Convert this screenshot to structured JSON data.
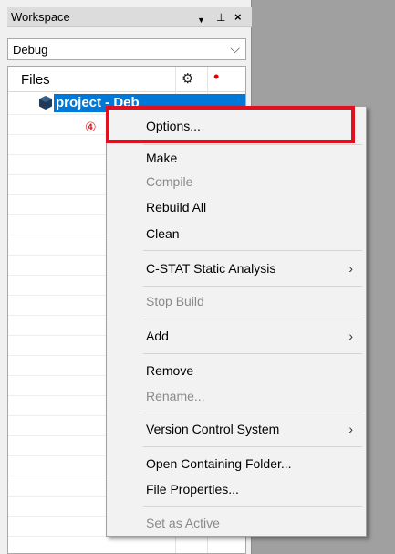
{
  "workspace": {
    "title": "Workspace",
    "controls": {
      "dropdown_icon": "▼",
      "pin_icon": "⊥",
      "close_icon": "×"
    },
    "configuration": {
      "value": "Debug"
    },
    "tree": {
      "header": {
        "files_label": "Files",
        "gear_icon": "gear-icon",
        "status_icon": "red-dot-icon"
      },
      "project": {
        "label": "project - Deb",
        "selected": true
      },
      "step_marker": "④"
    }
  },
  "context_menu": {
    "items": [
      {
        "label": "Options...",
        "enabled": true,
        "submenu": false
      },
      {
        "label": "Make",
        "enabled": true,
        "submenu": false
      },
      {
        "label": "Compile",
        "enabled": false,
        "submenu": false
      },
      {
        "label": "Rebuild All",
        "enabled": true,
        "submenu": false
      },
      {
        "label": "Clean",
        "enabled": true,
        "submenu": false
      },
      {
        "label": "C-STAT Static Analysis",
        "enabled": true,
        "submenu": true
      },
      {
        "label": "Stop Build",
        "enabled": false,
        "submenu": false
      },
      {
        "label": "Add",
        "enabled": true,
        "submenu": true
      },
      {
        "label": "Remove",
        "enabled": true,
        "submenu": false
      },
      {
        "label": "Rename...",
        "enabled": false,
        "submenu": false
      },
      {
        "label": "Version Control System",
        "enabled": true,
        "submenu": true
      },
      {
        "label": "Open Containing Folder...",
        "enabled": true,
        "submenu": false
      },
      {
        "label": "File Properties...",
        "enabled": true,
        "submenu": false
      },
      {
        "label": "Set as Active",
        "enabled": false,
        "submenu": false
      }
    ],
    "submenu_arrow": "›"
  },
  "colors": {
    "selection": "#0078d7",
    "highlight_box": "#e01020",
    "step_marker": "#e00000",
    "disabled_text": "#8a8a8a"
  }
}
